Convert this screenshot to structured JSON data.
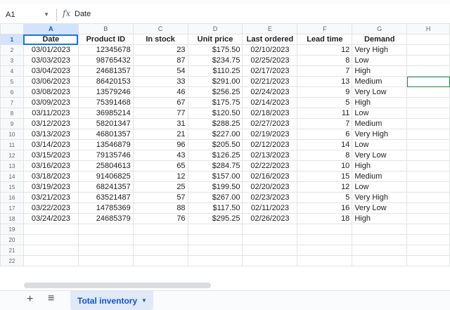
{
  "formula_bar": {
    "cell_ref": "A1",
    "fx_label": "fx",
    "formula": "Date"
  },
  "columns": [
    "A",
    "B",
    "C",
    "D",
    "E",
    "F",
    "G",
    "H"
  ],
  "header": [
    "Date",
    "Product ID",
    "In stock",
    "Unit price",
    "Last ordered",
    "Lead time",
    "Demand"
  ],
  "rows": [
    [
      "03/01/2023",
      "12345678",
      "23",
      "$175.50",
      "02/10/2023",
      "12",
      "Very High"
    ],
    [
      "03/03/2023",
      "98765432",
      "87",
      "$234.75",
      "02/25/2023",
      "8",
      "Low"
    ],
    [
      "03/04/2023",
      "24681357",
      "54",
      "$110.25",
      "02/17/2023",
      "7",
      "High"
    ],
    [
      "03/06/2023",
      "86420153",
      "33",
      "$291.00",
      "02/21/2023",
      "13",
      "Medium"
    ],
    [
      "03/08/2023",
      "13579246",
      "46",
      "$256.25",
      "02/24/2023",
      "9",
      "Very Low"
    ],
    [
      "03/09/2023",
      "75391468",
      "67",
      "$175.75",
      "02/14/2023",
      "5",
      "High"
    ],
    [
      "03/11/2023",
      "36985214",
      "77",
      "$120.50",
      "02/18/2023",
      "11",
      "Low"
    ],
    [
      "03/12/2023",
      "58201347",
      "31",
      "$288.25",
      "02/27/2023",
      "7",
      "Medium"
    ],
    [
      "03/13/2023",
      "46801357",
      "21",
      "$227.00",
      "02/19/2023",
      "6",
      "Very High"
    ],
    [
      "03/14/2023",
      "13546879",
      "96",
      "$205.50",
      "02/12/2023",
      "14",
      "Low"
    ],
    [
      "03/15/2023",
      "79135746",
      "43",
      "$126.25",
      "02/13/2023",
      "8",
      "Very Low"
    ],
    [
      "03/16/2023",
      "25804613",
      "65",
      "$284.75",
      "02/22/2023",
      "10",
      "High"
    ],
    [
      "03/18/2023",
      "91406825",
      "12",
      "$157.00",
      "02/16/2023",
      "15",
      "Medium"
    ],
    [
      "03/19/2023",
      "68241357",
      "25",
      "$199.50",
      "02/20/2023",
      "12",
      "Low"
    ],
    [
      "03/21/2023",
      "63521487",
      "57",
      "$267.00",
      "02/23/2023",
      "5",
      "Very High"
    ],
    [
      "03/22/2023",
      "14785369",
      "88",
      "$117.50",
      "02/11/2023",
      "16",
      "Very Low"
    ],
    [
      "03/24/2023",
      "24685379",
      "76",
      "$295.25",
      "02/26/2023",
      "18",
      "High"
    ]
  ],
  "row_numbers": [
    "1",
    "2",
    "3",
    "4",
    "5",
    "6",
    "7",
    "8",
    "9",
    "10",
    "11",
    "12",
    "13",
    "14",
    "15",
    "16",
    "17",
    "18",
    "19",
    "20",
    "21",
    "22"
  ],
  "sheet_tabs": [
    {
      "label": "Total inventory",
      "active": true
    }
  ],
  "icons": {
    "add_sheet": "plus-icon",
    "all_sheets": "menu-icon",
    "tab_dropdown": "chevron-down-icon"
  },
  "colors": {
    "selection_blue": "#1a73e8",
    "active_tab_bg": "#e1e9f7",
    "active_tab_text": "#0b57d0",
    "cursor_green": "#1e8e3e"
  }
}
